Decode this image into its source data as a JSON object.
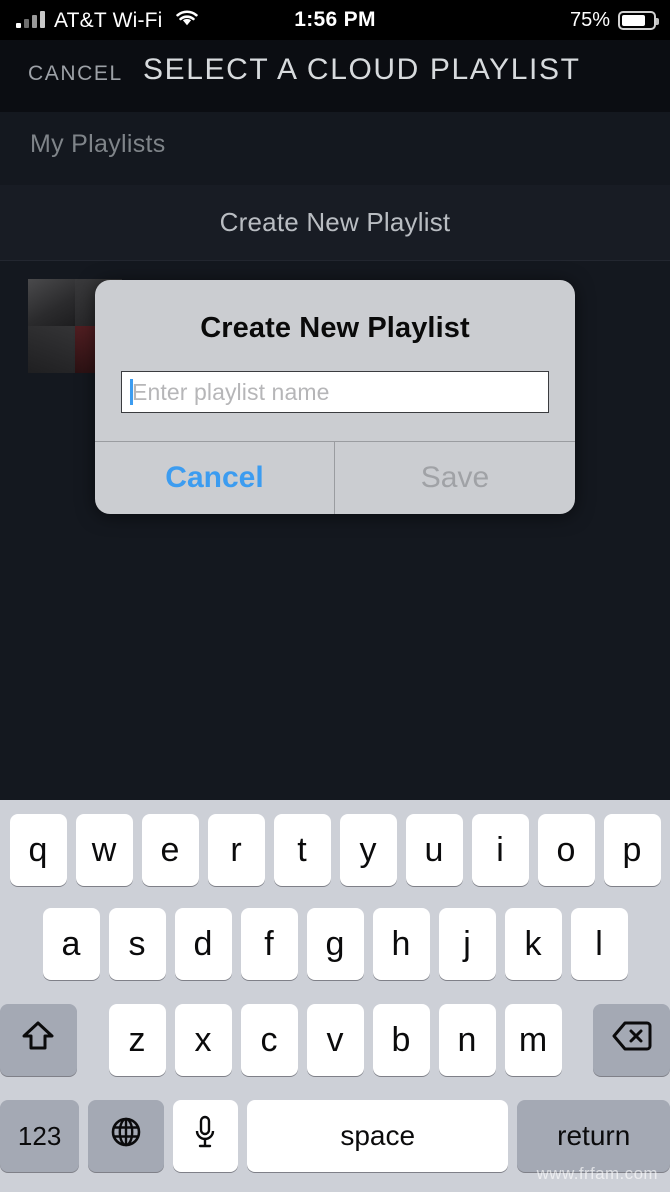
{
  "status_bar": {
    "carrier": "AT&T Wi-Fi",
    "time": "1:56 PM",
    "battery_percent": "75%",
    "battery_level": 75,
    "signal_bars": 4,
    "wifi_icon": "wifi-icon",
    "battery_icon": "battery-icon"
  },
  "nav": {
    "cancel_label": "CANCEL",
    "title": "SELECT A CLOUD PLAYLIST"
  },
  "list": {
    "section_header": "My Playlists",
    "create_row_label": "Create New Playlist"
  },
  "alert": {
    "title": "Create New Playlist",
    "input_value": "",
    "input_placeholder": "Enter playlist name",
    "cancel_label": "Cancel",
    "save_label": "Save",
    "cancel_color": "#3c9cf0",
    "save_color": "#a0a2a6",
    "background_color": "#cbcdd1"
  },
  "keyboard": {
    "row1": [
      "q",
      "w",
      "e",
      "r",
      "t",
      "y",
      "u",
      "i",
      "o",
      "p"
    ],
    "row2": [
      "a",
      "s",
      "d",
      "f",
      "g",
      "h",
      "j",
      "k",
      "l"
    ],
    "row3": [
      "z",
      "x",
      "c",
      "v",
      "b",
      "n",
      "m"
    ],
    "shift_icon": "shift-arrow-icon",
    "delete_icon": "backspace-delete-icon",
    "numbers_label": "123",
    "globe_icon": "globe-icon",
    "mic_icon": "microphone-icon",
    "space_label": "space",
    "return_label": "return"
  },
  "watermark": {
    "text": "www.frfam.com"
  }
}
